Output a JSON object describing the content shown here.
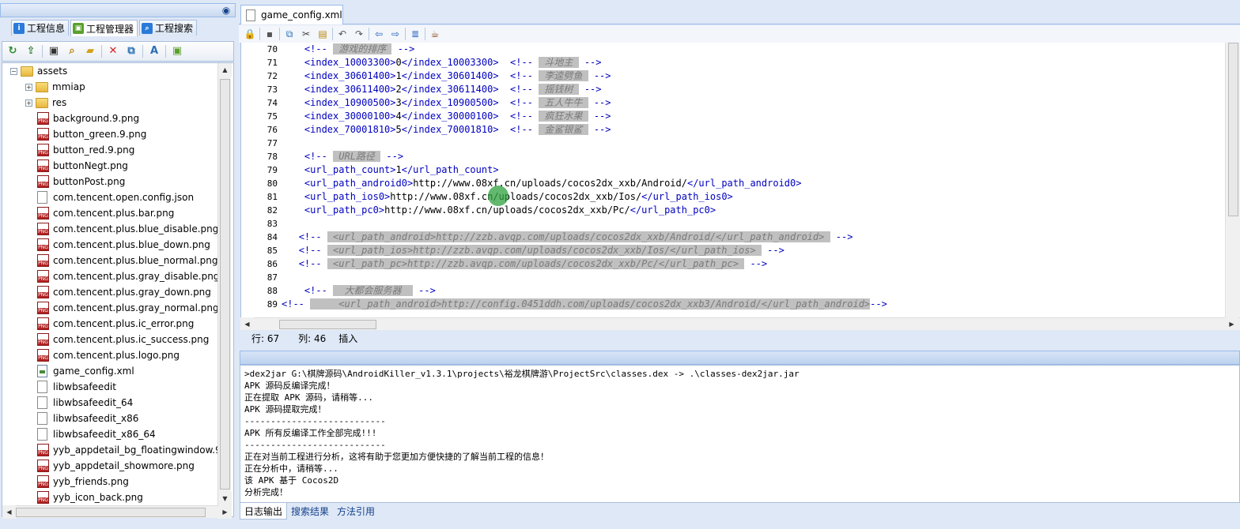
{
  "left_panel": {
    "tabs": [
      {
        "label": "工程信息",
        "icon": "info-icon",
        "color": "#2a7bd8"
      },
      {
        "label": "工程管理器",
        "icon": "android-icon",
        "color": "#5aa02c"
      },
      {
        "label": "工程搜索",
        "icon": "search-icon",
        "color": "#2a7bd8"
      }
    ],
    "toolbar": [
      "refresh-icon",
      "export-icon",
      "window-icon",
      "find-icon",
      "folder-icon",
      "delete-icon",
      "copy-icon",
      "text-icon",
      "android-icon"
    ],
    "tree": {
      "root": "assets",
      "items": [
        {
          "name": "mmiap",
          "type": "folder"
        },
        {
          "name": "res",
          "type": "folder"
        },
        {
          "name": "background.9.png",
          "type": "png"
        },
        {
          "name": "button_green.9.png",
          "type": "png"
        },
        {
          "name": "button_red.9.png",
          "type": "png"
        },
        {
          "name": "buttonNegt.png",
          "type": "png"
        },
        {
          "name": "buttonPost.png",
          "type": "png"
        },
        {
          "name": "com.tencent.open.config.json",
          "type": "file"
        },
        {
          "name": "com.tencent.plus.bar.png",
          "type": "png"
        },
        {
          "name": "com.tencent.plus.blue_disable.png",
          "type": "png"
        },
        {
          "name": "com.tencent.plus.blue_down.png",
          "type": "png"
        },
        {
          "name": "com.tencent.plus.blue_normal.png",
          "type": "png"
        },
        {
          "name": "com.tencent.plus.gray_disable.png",
          "type": "png"
        },
        {
          "name": "com.tencent.plus.gray_down.png",
          "type": "png"
        },
        {
          "name": "com.tencent.plus.gray_normal.png",
          "type": "png"
        },
        {
          "name": "com.tencent.plus.ic_error.png",
          "type": "png"
        },
        {
          "name": "com.tencent.plus.ic_success.png",
          "type": "png"
        },
        {
          "name": "com.tencent.plus.logo.png",
          "type": "png"
        },
        {
          "name": "game_config.xml",
          "type": "xml"
        },
        {
          "name": "libwbsafeedit",
          "type": "file"
        },
        {
          "name": "libwbsafeedit_64",
          "type": "file"
        },
        {
          "name": "libwbsafeedit_x86",
          "type": "file"
        },
        {
          "name": "libwbsafeedit_x86_64",
          "type": "file"
        },
        {
          "name": "yyb_appdetail_bg_floatingwindow.9.",
          "type": "png"
        },
        {
          "name": "yyb_appdetail_showmore.png",
          "type": "png"
        },
        {
          "name": "yyb_friends.png",
          "type": "png"
        },
        {
          "name": "yyb_icon_back.png",
          "type": "png"
        }
      ]
    }
  },
  "editor": {
    "tab_label": "game_config.xml",
    "toolbar": [
      "lock-icon",
      "save-icon",
      "copy-icon",
      "cut-icon",
      "paste-icon",
      "undo-icon",
      "redo-icon",
      "back-icon",
      "forward-icon",
      "format-icon",
      "java-icon"
    ],
    "lines": [
      {
        "n": "70",
        "parts": [
          [
            "i",
            "    "
          ],
          [
            "c",
            "<!-- "
          ],
          [
            "cb",
            " 游戏的排序 "
          ],
          [
            "c",
            " -->"
          ]
        ]
      },
      {
        "n": "71",
        "parts": [
          [
            "i",
            "    "
          ],
          [
            "t",
            "<index_10003300>"
          ],
          [
            "x",
            "0"
          ],
          [
            "t",
            "</index_10003300>"
          ],
          [
            "x",
            "  "
          ],
          [
            "c",
            "<!-- "
          ],
          [
            "cb",
            " 斗地主 "
          ],
          [
            "c",
            " -->"
          ]
        ]
      },
      {
        "n": "72",
        "parts": [
          [
            "i",
            "    "
          ],
          [
            "t",
            "<index_30601400>"
          ],
          [
            "x",
            "1"
          ],
          [
            "t",
            "</index_30601400>"
          ],
          [
            "x",
            "  "
          ],
          [
            "c",
            "<!-- "
          ],
          [
            "cb",
            " 李逵劈鱼 "
          ],
          [
            "c",
            " -->"
          ]
        ]
      },
      {
        "n": "73",
        "parts": [
          [
            "i",
            "    "
          ],
          [
            "t",
            "<index_30611400>"
          ],
          [
            "x",
            "2"
          ],
          [
            "t",
            "</index_30611400>"
          ],
          [
            "x",
            "  "
          ],
          [
            "c",
            "<!-- "
          ],
          [
            "cb",
            " 摇钱树 "
          ],
          [
            "c",
            " -->"
          ]
        ]
      },
      {
        "n": "74",
        "parts": [
          [
            "i",
            "    "
          ],
          [
            "t",
            "<index_10900500>"
          ],
          [
            "x",
            "3"
          ],
          [
            "t",
            "</index_10900500>"
          ],
          [
            "x",
            "  "
          ],
          [
            "c",
            "<!-- "
          ],
          [
            "cb",
            " 五人牛牛 "
          ],
          [
            "c",
            " -->"
          ]
        ]
      },
      {
        "n": "75",
        "parts": [
          [
            "i",
            "    "
          ],
          [
            "t",
            "<index_30000100>"
          ],
          [
            "x",
            "4"
          ],
          [
            "t",
            "</index_30000100>"
          ],
          [
            "x",
            "  "
          ],
          [
            "c",
            "<!-- "
          ],
          [
            "cb",
            " 疯狂水果 "
          ],
          [
            "c",
            " -->"
          ]
        ]
      },
      {
        "n": "76",
        "parts": [
          [
            "i",
            "    "
          ],
          [
            "t",
            "<index_70001810>"
          ],
          [
            "x",
            "5"
          ],
          [
            "t",
            "</index_70001810>"
          ],
          [
            "x",
            "  "
          ],
          [
            "c",
            "<!-- "
          ],
          [
            "cb",
            " 金鲨银鲨 "
          ],
          [
            "c",
            " -->"
          ]
        ]
      },
      {
        "n": "77",
        "parts": []
      },
      {
        "n": "78",
        "parts": [
          [
            "i",
            "    "
          ],
          [
            "c",
            "<!-- "
          ],
          [
            "cb",
            " URL路径 "
          ],
          [
            "c",
            " -->"
          ]
        ]
      },
      {
        "n": "79",
        "parts": [
          [
            "i",
            "    "
          ],
          [
            "t",
            "<url_path_count>"
          ],
          [
            "x",
            "1"
          ],
          [
            "t",
            "</url_path_count>"
          ]
        ]
      },
      {
        "n": "80",
        "parts": [
          [
            "i",
            "    "
          ],
          [
            "t",
            "<url_path_android0>"
          ],
          [
            "x",
            "http://www.08xf.cn/uploads/cocos2dx_xxb/Android/"
          ],
          [
            "t",
            "</url_path_android0>"
          ]
        ]
      },
      {
        "n": "81",
        "parts": [
          [
            "i",
            "    "
          ],
          [
            "t",
            "<url_path_ios0>"
          ],
          [
            "x",
            "http://www.08xf.cn/uploads/cocos2dx_xxb/Ios/"
          ],
          [
            "t",
            "</url_path_ios0>"
          ]
        ]
      },
      {
        "n": "82",
        "parts": [
          [
            "i",
            "    "
          ],
          [
            "t",
            "<url_path_pc0>"
          ],
          [
            "x",
            "http://www.08xf.cn/uploads/cocos2dx_xxb/Pc/"
          ],
          [
            "t",
            "</url_path_pc0>"
          ]
        ]
      },
      {
        "n": "83",
        "parts": []
      },
      {
        "n": "84",
        "parts": [
          [
            "i",
            "   "
          ],
          [
            "c",
            "<!-- "
          ],
          [
            "cb",
            " <url_path_android>http://zzb.avqp.com/uploads/cocos2dx_xxb/Android/</url_path_android> "
          ],
          [
            "c",
            " -->"
          ]
        ]
      },
      {
        "n": "85",
        "parts": [
          [
            "i",
            "   "
          ],
          [
            "c",
            "<!-- "
          ],
          [
            "cb",
            " <url_path_ios>http://zzb.avqp.com/uploads/cocos2dx_xxb/Ios/</url_path_ios> "
          ],
          [
            "c",
            " -->"
          ]
        ]
      },
      {
        "n": "86",
        "parts": [
          [
            "i",
            "   "
          ],
          [
            "c",
            "<!-- "
          ],
          [
            "cb",
            " <url_path_pc>http://zzb.avqp.com/uploads/cocos2dx_xxb/Pc/</url_path_pc> "
          ],
          [
            "c",
            " -->"
          ]
        ]
      },
      {
        "n": "87",
        "parts": []
      },
      {
        "n": "88",
        "parts": [
          [
            "i",
            "    "
          ],
          [
            "c",
            "<!-- "
          ],
          [
            "cb",
            "  大都会服务器  "
          ],
          [
            "c",
            " -->"
          ]
        ]
      },
      {
        "n": "89",
        "parts": [
          [
            "c",
            "<!-- "
          ],
          [
            "cb",
            "     <url_path_android>http://config.0451ddh.com/uploads/cocos2dx_xxb3/Android/</url_path_android>"
          ],
          [
            "c",
            "-->"
          ]
        ]
      }
    ],
    "status": {
      "row_label": "行: 67",
      "col_label": "列: 46",
      "mode_label": "插入"
    }
  },
  "log": {
    "lines": [
      ">dex2jar G:\\棋牌源码\\AndroidKiller_v1.3.1\\projects\\裕龙棋牌游\\ProjectSrc\\classes.dex -> .\\classes-dex2jar.jar",
      "APK 源码反编译完成！",
      "正在提取 APK 源码，请稍等...",
      "APK 源码提取完成！",
      "---------------------------",
      "APK 所有反编译工作全部完成!!!",
      "---------------------------",
      "正在对当前工程进行分析，这将有助于您更加方便快捷的了解当前工程的信息！",
      "正在分析中，请稍等...",
      "该 APK 基于 Cocos2D",
      "分析完成！"
    ],
    "tabs": [
      {
        "label": "日志输出",
        "active": true
      },
      {
        "label": "搜索结果",
        "active": false
      },
      {
        "label": "方法引用",
        "active": false
      }
    ]
  }
}
